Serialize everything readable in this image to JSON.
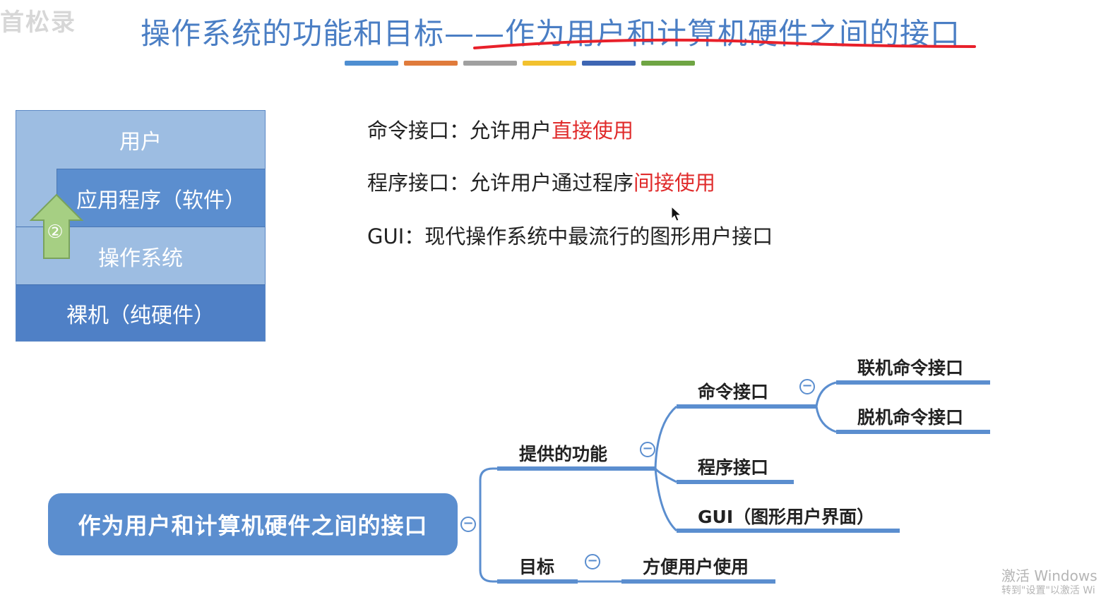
{
  "watermark": "首松录",
  "title": "操作系统的功能和目标——作为用户和计算机硬件之间的接口",
  "color_bars": [
    "#4e8ed1",
    "#e07b3b",
    "#a0a0a0",
    "#f2c12e",
    "#3e66b3",
    "#6fa544"
  ],
  "stack": {
    "user": "用户",
    "app": "应用程序（软件）",
    "os": "操作系统",
    "hardware": "裸机（纯硬件）",
    "arrow_number": "②"
  },
  "descriptions": {
    "cmd_prefix": "命令接口：允许用户",
    "cmd_highlight": "直接使用",
    "prog_prefix": "程序接口：允许用户通过程序",
    "prog_highlight": "间接使用",
    "gui": "GUI：现代操作系统中最流行的图形用户接口"
  },
  "mindmap": {
    "root": "作为用户和计算机硬件之间的接口",
    "functions": "提供的功能",
    "cmd_interface": "命令接口",
    "online_cmd": "联机命令接口",
    "offline_cmd": "脱机命令接口",
    "prog_interface": "程序接口",
    "gui": "GUI（图形用户界面）",
    "goal": "目标",
    "convenient": "方便用户使用",
    "collapse_symbol": "−"
  },
  "windows_activation": {
    "title": "激活 Windows",
    "subtitle": "转到\"设置\"以激活 Wi"
  },
  "colors": {
    "accent": "#5b8ecf",
    "title": "#4a7ec4",
    "highlight_red": "#e02b2b",
    "red_underline": "#e8202a"
  }
}
